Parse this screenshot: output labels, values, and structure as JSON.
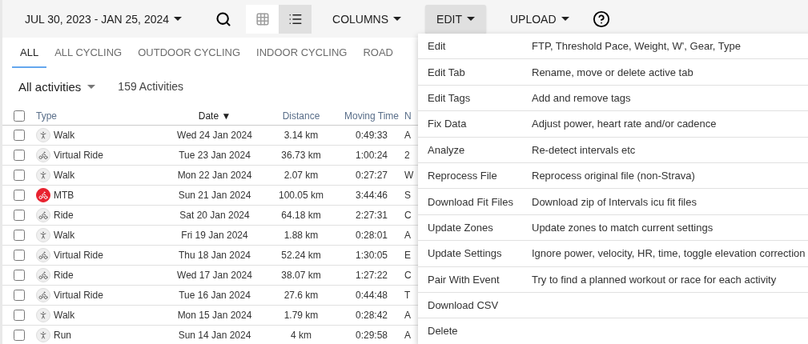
{
  "toolbar": {
    "date_range": "JUL 30, 2023 - JAN 25, 2024",
    "views": [
      {
        "kind": "grid",
        "selected": false
      },
      {
        "kind": "list",
        "selected": true
      }
    ],
    "menus": [
      {
        "label": "COLUMNS",
        "selected": false
      },
      {
        "label": "EDIT",
        "selected": true
      },
      {
        "label": "UPLOAD",
        "selected": false
      }
    ]
  },
  "tabs": [
    {
      "label": "ALL",
      "selected": true
    },
    {
      "label": "ALL CYCLING",
      "selected": false
    },
    {
      "label": "OUTDOOR CYCLING",
      "selected": false
    },
    {
      "label": "INDOOR CYCLING",
      "selected": false
    },
    {
      "label": "ROAD",
      "selected": false
    }
  ],
  "filter": {
    "value": "All activities",
    "count": "159 Activities"
  },
  "table": {
    "select_all_checked": false,
    "columns": [
      {
        "label": "Type",
        "sorted": false
      },
      {
        "label": "Date ▼",
        "sorted": true
      },
      {
        "label": "Distance",
        "sorted": false
      },
      {
        "label": "Moving Time",
        "sorted": false
      },
      {
        "label": "N",
        "sorted": false
      }
    ],
    "rows": [
      {
        "checked": false,
        "kind": "walk",
        "highlighted": false,
        "type": "Walk",
        "date": "Wed 24 Jan 2024",
        "distance": "3.14 km",
        "moving_time": "0:49:33",
        "column_5": "A"
      },
      {
        "checked": false,
        "kind": "ride",
        "highlighted": false,
        "type": "Virtual Ride",
        "date": "Tue 23 Jan 2024",
        "distance": "36.73 km",
        "moving_time": "1:00:24",
        "column_5": "2"
      },
      {
        "checked": false,
        "kind": "walk",
        "highlighted": false,
        "type": "Walk",
        "date": "Mon 22 Jan 2024",
        "distance": "2.07 km",
        "moving_time": "0:27:27",
        "column_5": "W"
      },
      {
        "checked": false,
        "kind": "ride",
        "highlighted": true,
        "type": "MTB",
        "date": "Sun 21 Jan 2024",
        "distance": "100.05 km",
        "moving_time": "3:44:46",
        "column_5": "S"
      },
      {
        "checked": false,
        "kind": "ride",
        "highlighted": false,
        "type": "Ride",
        "date": "Sat 20 Jan 2024",
        "distance": "64.18 km",
        "moving_time": "2:27:31",
        "column_5": "C"
      },
      {
        "checked": false,
        "kind": "walk",
        "highlighted": false,
        "type": "Walk",
        "date": "Fri 19 Jan 2024",
        "distance": "1.88 km",
        "moving_time": "0:28:01",
        "column_5": "A"
      },
      {
        "checked": false,
        "kind": "ride",
        "highlighted": false,
        "type": "Virtual Ride",
        "date": "Thu 18 Jan 2024",
        "distance": "52.24 km",
        "moving_time": "1:30:05",
        "column_5": "E"
      },
      {
        "checked": false,
        "kind": "ride",
        "highlighted": false,
        "type": "Ride",
        "date": "Wed 17 Jan 2024",
        "distance": "38.07 km",
        "moving_time": "1:27:22",
        "column_5": "C"
      },
      {
        "checked": false,
        "kind": "ride",
        "highlighted": false,
        "type": "Virtual Ride",
        "date": "Tue 16 Jan 2024",
        "distance": "27.6 km",
        "moving_time": "0:44:48",
        "column_5": "T"
      },
      {
        "checked": false,
        "kind": "walk",
        "highlighted": false,
        "type": "Walk",
        "date": "Mon 15 Jan 2024",
        "distance": "1.79 km",
        "moving_time": "0:28:42",
        "column_5": "A"
      },
      {
        "checked": false,
        "kind": "walk",
        "highlighted": false,
        "type": "Run",
        "date": "Sun 14 Jan 2024",
        "distance": "4 km",
        "moving_time": "0:29:58",
        "column_5": "A"
      }
    ]
  },
  "edit_menu": {
    "items": [
      {
        "label": "Edit",
        "description": "FTP, Threshold Pace, Weight, W', Gear, Type"
      },
      {
        "label": "Edit Tab",
        "description": "Rename, move or delete active tab"
      },
      {
        "label": "Edit Tags",
        "description": "Add and remove tags"
      },
      {
        "label": "Fix Data",
        "description": "Adjust power, heart rate and/or cadence"
      },
      {
        "label": "Analyze",
        "description": "Re-detect intervals etc"
      },
      {
        "label": "Reprocess File",
        "description": "Reprocess original file (non-Strava)"
      },
      {
        "label": "Download Fit Files",
        "description": "Download zip of Intervals icu fit files"
      },
      {
        "label": "Update Zones",
        "description": "Update zones to match current settings"
      },
      {
        "label": "Update Settings",
        "description": "Ignore power, velocity, HR, time, toggle elevation correction"
      },
      {
        "label": "Pair With Event",
        "description": "Try to find a planned workout or race for each activity"
      },
      {
        "label": "Download CSV"
      },
      {
        "label": "Delete"
      }
    ]
  }
}
